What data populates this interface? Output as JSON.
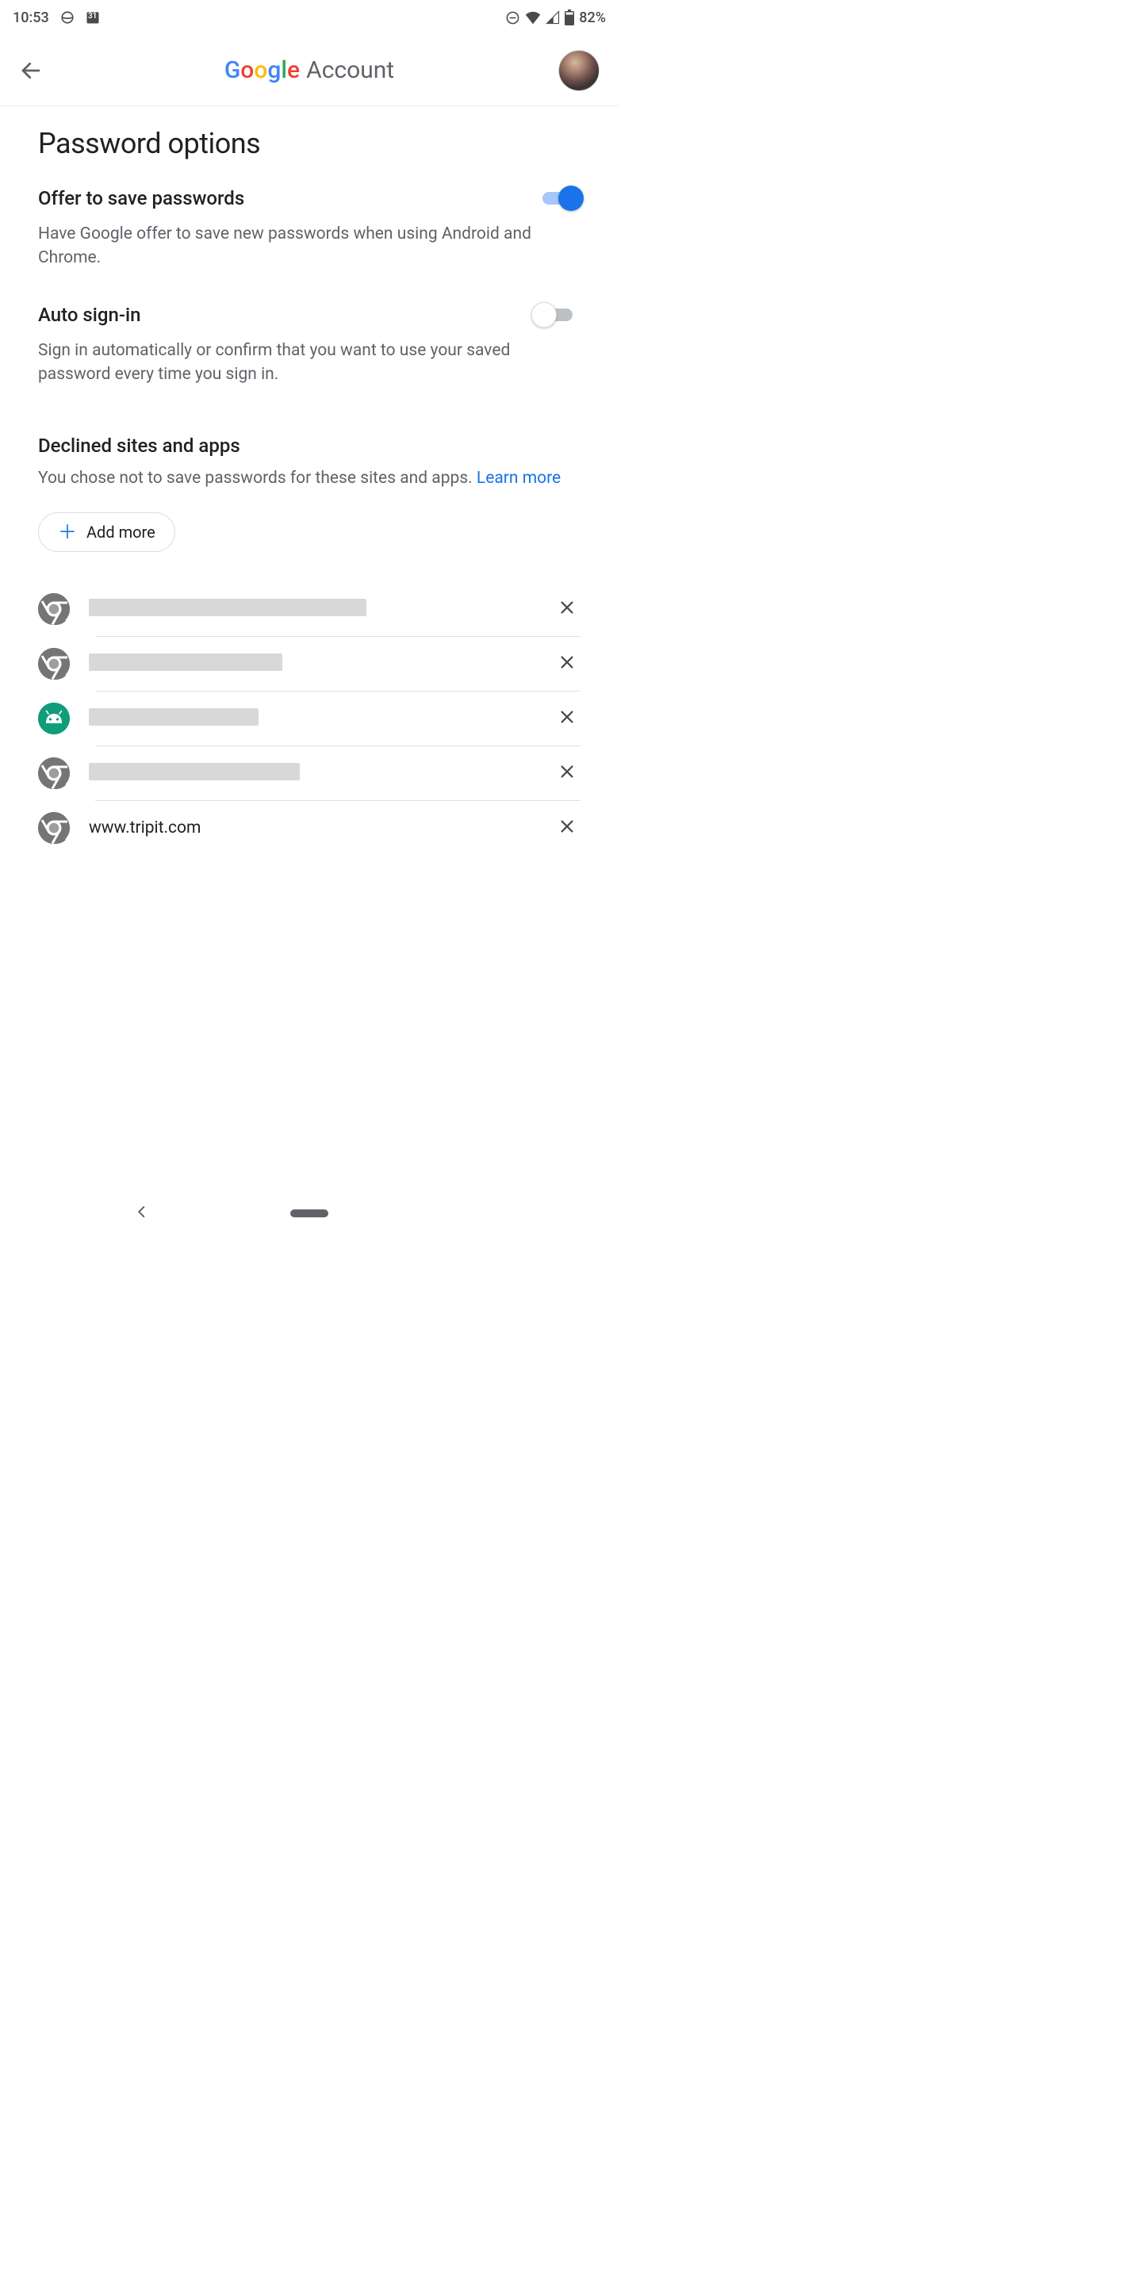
{
  "status_bar": {
    "time": "10:53",
    "calendar_badge": "31",
    "battery_percent": "82%"
  },
  "header": {
    "brand_word": "Google",
    "brand_suffix": "Account"
  },
  "page": {
    "title": "Password options"
  },
  "settings": {
    "offer_save": {
      "title": "Offer to save passwords",
      "description": "Have Google offer to save new passwords when using Android and Chrome.",
      "enabled": true
    },
    "auto_sign_in": {
      "title": "Auto sign-in",
      "description": "Sign in automatically or confirm that you want to use your saved password every time you sign in.",
      "enabled": false
    }
  },
  "declined": {
    "title": "Declined sites and apps",
    "description_prefix": "You chose not to save passwords for these sites and apps. ",
    "learn_more_label": "Learn more",
    "add_more_label": "Add more",
    "items": [
      {
        "icon": "chrome",
        "label": "",
        "redacted": true,
        "redact_width": 350
      },
      {
        "icon": "chrome",
        "label": "",
        "redacted": true,
        "redact_width": 244
      },
      {
        "icon": "android",
        "label": "",
        "redacted": true,
        "redact_width": 214
      },
      {
        "icon": "chrome",
        "label": "",
        "redacted": true,
        "redact_width": 266
      },
      {
        "icon": "chrome",
        "label": "www.tripit.com",
        "redacted": false,
        "redact_width": 0
      }
    ]
  }
}
